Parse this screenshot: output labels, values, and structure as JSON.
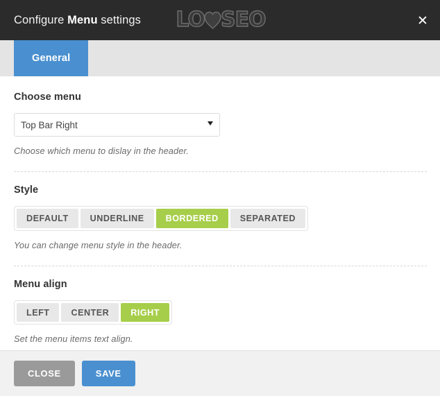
{
  "header": {
    "title_prefix": "Configure ",
    "title_strong": "Menu",
    "title_suffix": " settings",
    "logo_left": "LO",
    "logo_right": "SEO",
    "logo_name": "LOYSEO",
    "close_icon": "✕",
    "bg_color": "#2b2b2b"
  },
  "tabs": [
    {
      "label": "General",
      "active": true
    }
  ],
  "tab_bar": {
    "bg_color": "#e4e4e4",
    "active_color": "#4a90d0"
  },
  "fields": {
    "choose_menu": {
      "label": "Choose menu",
      "selected": "Top Bar Right",
      "placeholder": "Top Bar Right",
      "help": "Choose which menu to dislay in the header.",
      "arrow_icon": "chevron-down-icon"
    },
    "style": {
      "label": "Style",
      "options": [
        "DEFAULT",
        "UNDERLINE",
        "BORDERED",
        "SEPARATED"
      ],
      "selected": "BORDERED",
      "help": "You can change menu style in the header."
    },
    "menu_align": {
      "label": "Menu align",
      "options": [
        "LEFT",
        "CENTER",
        "RIGHT"
      ],
      "selected": "RIGHT",
      "help": "Set the menu items text align."
    }
  },
  "footer": {
    "close_label": "CLOSE",
    "save_label": "SAVE",
    "close_color": "#9a9a9a",
    "save_color": "#4a90d0",
    "bg_color": "#f1f1f1"
  },
  "colors": {
    "accent_green": "#a7ce4b",
    "accent_blue": "#4a90d0",
    "dark": "#2b2b2b"
  }
}
